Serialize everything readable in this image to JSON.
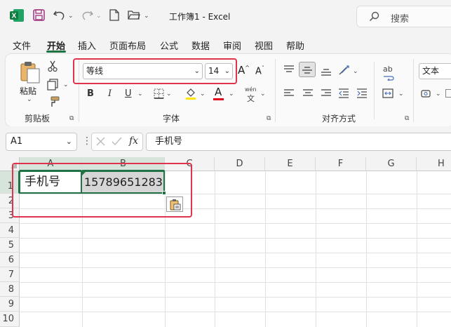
{
  "app": {
    "title": "工作簿1 - Excel",
    "search_placeholder": "搜索",
    "colors": {
      "accent": "#217346",
      "highlight_box": "#e0344e",
      "excel_icon": "#1d6f42"
    }
  },
  "quick_access": [
    "excel-icon",
    "save-icon",
    "undo-icon",
    "redo-icon",
    "new-file-icon",
    "open-folder-icon"
  ],
  "menu": {
    "items": [
      "文件",
      "开始",
      "插入",
      "页面布局",
      "公式",
      "数据",
      "审阅",
      "视图",
      "帮助"
    ],
    "active": "开始"
  },
  "ribbon": {
    "clipboard": {
      "group_label": "剪贴板",
      "paste_label": "粘贴"
    },
    "font": {
      "group_label": "字体",
      "font_name": "等线",
      "font_size": "14",
      "bold": "B",
      "italic": "I",
      "underline": "U",
      "grow": "A",
      "shrink": "A",
      "font_color_letter": "A",
      "phonetic_top": "wén",
      "phonetic_bottom": "文"
    },
    "alignment": {
      "group_label": "对齐方式",
      "wrap_text": "ab"
    },
    "number": {
      "format": "文本"
    }
  },
  "formula_bar": {
    "name_box": "A1",
    "fx": "fx",
    "content": "手机号"
  },
  "sheet": {
    "columns": [
      "A",
      "B",
      "C",
      "D",
      "E",
      "F",
      "G",
      "H"
    ],
    "rows": [
      "1",
      "2",
      "3",
      "4",
      "5",
      "6",
      "7",
      "8",
      "9",
      "10"
    ],
    "cells": {
      "A1": "手机号",
      "B1": "15789651283"
    }
  }
}
